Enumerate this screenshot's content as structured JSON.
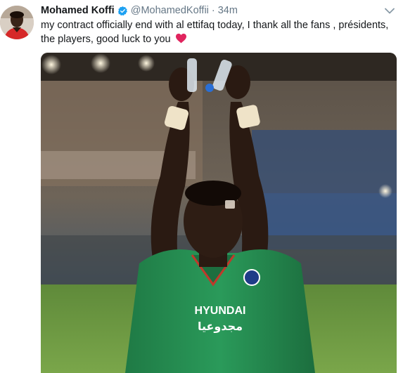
{
  "tweet": {
    "display_name": "Mohamed Koffi",
    "handle": "@MohamedKoffii",
    "separator": "·",
    "time": "34m",
    "text": "my contract officially end with al ettifaq today, I thank all the fans , présidents, the players, good luck to you",
    "emoji": "heart-emoji",
    "verified_color": "#1da1f2",
    "heart_color": "#e0245e"
  },
  "photo": {
    "jersey_text_1": "HYUNDAI",
    "jersey_text_2": "مجدوعيا"
  },
  "icons": {
    "verified": "verified-badge-icon",
    "caret": "chevron-down-icon"
  }
}
